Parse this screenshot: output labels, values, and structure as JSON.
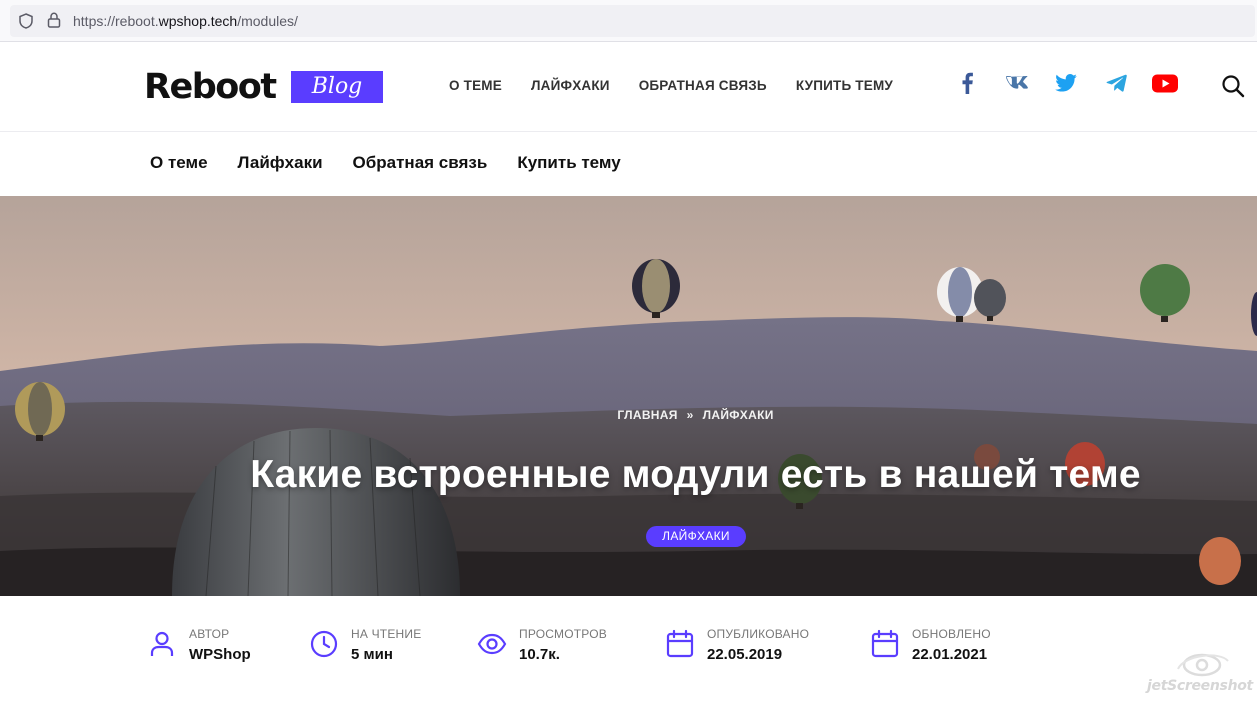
{
  "browser": {
    "url_prefix": "https://reboot.",
    "url_host": "wpshop.tech",
    "url_path": "/modules/",
    "icons": [
      "shield-icon",
      "lock-icon"
    ]
  },
  "header": {
    "logo_text": "Reboot",
    "logo_badge": "Blog",
    "nav": [
      "О ТЕМЕ",
      "ЛАЙФХАКИ",
      "ОБРАТНАЯ СВЯЗЬ",
      "КУПИТЬ ТЕМУ"
    ],
    "social": [
      {
        "name": "facebook-icon",
        "color": "#3b5998"
      },
      {
        "name": "vk-icon",
        "color": "#4a76a8"
      },
      {
        "name": "twitter-icon",
        "color": "#1da1f2"
      },
      {
        "name": "telegram-icon",
        "color": "#2ca5e0"
      },
      {
        "name": "youtube-icon",
        "color": "#ff0000"
      }
    ],
    "search_icon": "search-icon"
  },
  "subnav": [
    "О теме",
    "Лайфхаки",
    "Обратная связь",
    "Купить тему"
  ],
  "hero": {
    "breadcrumb_home": "ГЛАВНАЯ",
    "breadcrumb_sep": "»",
    "breadcrumb_category": "ЛАЙФХАКИ",
    "title": "Какие встроенные модули есть в нашей теме",
    "tag": "ЛАЙФХАКИ"
  },
  "meta": [
    {
      "icon": "user-icon",
      "label": "АВТОР",
      "value": "WPShop"
    },
    {
      "icon": "clock-icon",
      "label": "НА ЧТЕНИЕ",
      "value": "5 мин"
    },
    {
      "icon": "eye-icon",
      "label": "ПРОСМОТРОВ",
      "value": "10.7к."
    },
    {
      "icon": "calendar-icon",
      "label": "ОПУБЛИКОВАНО",
      "value": "22.05.2019"
    },
    {
      "icon": "calendar-icon",
      "label": "ОБНОВЛЕНО",
      "value": "22.01.2021"
    }
  ],
  "watermark": "jetScreenshot",
  "colors": {
    "accent": "#5a3dff",
    "meta_icon": "#5a3dff"
  }
}
